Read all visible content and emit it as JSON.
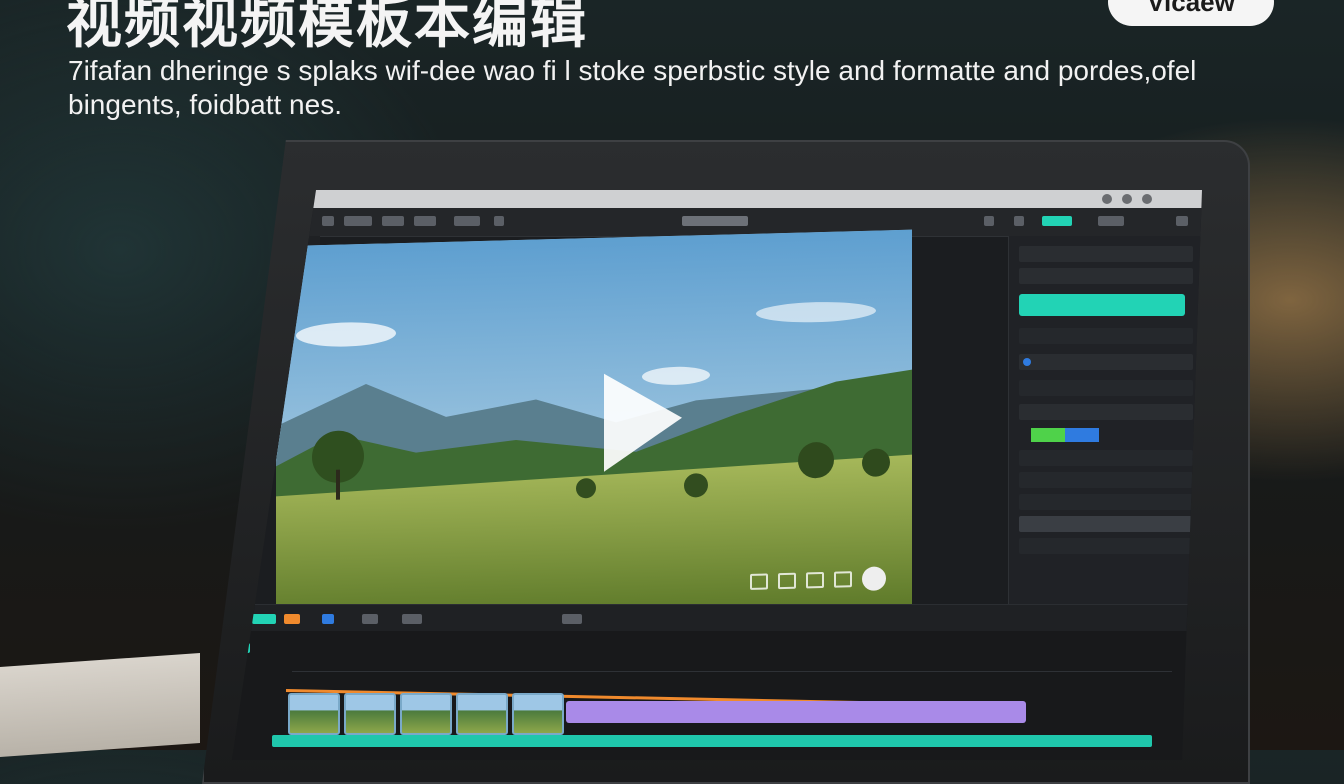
{
  "hero": {
    "headline": "视频视频模板本编辑",
    "subheadline": "7ifafan dheringe s splaks wif-dee wao fi l stoke sperbstic style and formatte and pordes,ofel bingents, foidbatt nes.",
    "brand_badge": "Vicaew"
  },
  "editor": {
    "export_button_label": "",
    "colors": {
      "accent": "#22d3b5",
      "timeline_orange": "#f08a2d",
      "clip_purple": "#a98ae8",
      "clip_teal": "#1fc7ac",
      "selection_blue": "#2f7be0",
      "selection_green": "#4fd24a"
    },
    "icons": {
      "play": "play-icon",
      "preview_controls": [
        "crop-icon",
        "split-icon",
        "subtitle-icon",
        "volume-icon"
      ],
      "record": "record-icon"
    },
    "ruler_ticks": [
      "",
      "",
      "",
      "",
      "",
      "",
      "",
      "",
      "",
      "",
      "",
      ""
    ]
  }
}
